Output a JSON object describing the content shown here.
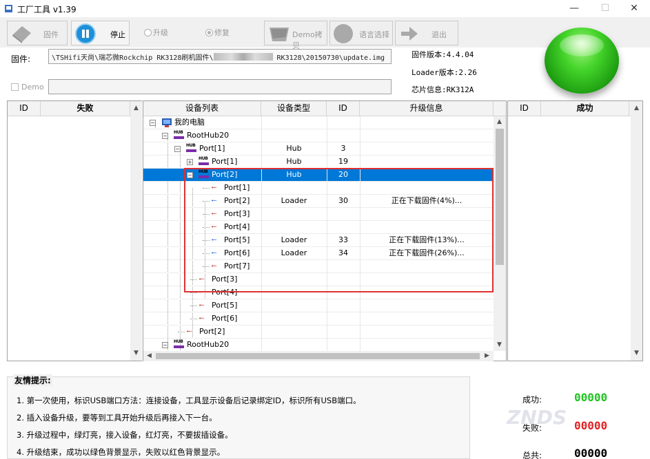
{
  "window": {
    "title": "工厂工具 v1.39",
    "minimize": "—",
    "maximize": "☐",
    "close": "✕"
  },
  "toolbar": {
    "firmware_label": "固件",
    "stop_label": "停止",
    "upgrade_label": "升级",
    "repair_label": "修复",
    "demo_copy_label": "Demo拷贝",
    "language_label": "语言选择",
    "exit_label": "退出"
  },
  "firmware": {
    "label": "固件:",
    "path_prefix": "\\TSHifi天尚\\瑞芯微Rockchip RK3128刷机固件\\",
    "path_suffix": "RK3128\\20150730\\update.img"
  },
  "info": {
    "fw_version_label": "固件版本:",
    "fw_version": "4.4.04",
    "loader_version_label": "Loader版本:",
    "loader_version": "2.26",
    "chip_label": "芯片信息:",
    "chip": "RK312A"
  },
  "demo": {
    "label": "Demo"
  },
  "fail_panel": {
    "col_id": "ID",
    "col_title": "失败"
  },
  "success_panel": {
    "col_id": "ID",
    "col_title": "成功"
  },
  "device_table": {
    "headers": [
      "设备列表",
      "设备类型",
      "ID",
      "升级信息"
    ],
    "rows": [
      {
        "name": "我的电脑",
        "type": "",
        "id": "",
        "info": ""
      },
      {
        "name": "RootHub20",
        "type": "",
        "id": "",
        "info": ""
      },
      {
        "name": "Port[1]",
        "type": "Hub",
        "id": "3",
        "info": ""
      },
      {
        "name": "Port[1]",
        "type": "Hub",
        "id": "19",
        "info": ""
      },
      {
        "name": "Port[2]",
        "type": "Hub",
        "id": "20",
        "info": ""
      },
      {
        "name": "Port[1]",
        "type": "",
        "id": "",
        "info": ""
      },
      {
        "name": "Port[2]",
        "type": "Loader",
        "id": "30",
        "info": "正在下载固件(4%)..."
      },
      {
        "name": "Port[3]",
        "type": "",
        "id": "",
        "info": ""
      },
      {
        "name": "Port[4]",
        "type": "",
        "id": "",
        "info": ""
      },
      {
        "name": "Port[5]",
        "type": "Loader",
        "id": "33",
        "info": "正在下载固件(13%)..."
      },
      {
        "name": "Port[6]",
        "type": "Loader",
        "id": "34",
        "info": "正在下载固件(26%)..."
      },
      {
        "name": "Port[7]",
        "type": "",
        "id": "",
        "info": ""
      },
      {
        "name": "Port[3]",
        "type": "",
        "id": "",
        "info": ""
      },
      {
        "name": "Port[4]",
        "type": "",
        "id": "",
        "info": ""
      },
      {
        "name": "Port[5]",
        "type": "",
        "id": "",
        "info": ""
      },
      {
        "name": "Port[6]",
        "type": "",
        "id": "",
        "info": ""
      },
      {
        "name": "Port[2]",
        "type": "",
        "id": "",
        "info": ""
      },
      {
        "name": "RootHub20",
        "type": "",
        "id": "",
        "info": ""
      }
    ]
  },
  "tips": {
    "title": "友情提示:",
    "items": [
      "1. 第一次使用，标识USB端口方法：连接设备，工具显示设备后记录绑定ID，标识所有USB端口。",
      "2. 插入设备升级，要等到工具开始升级后再接入下一台。",
      "3. 升级过程中，绿灯亮，接入设备，红灯亮，不要拔插设备。",
      "4. 升级结束，成功以绿色背景显示，失败以红色背景显示。"
    ]
  },
  "stats": {
    "success_label": "成功:",
    "success_value": "00000",
    "fail_label": "失败:",
    "fail_value": "00000",
    "total_label": "总共:",
    "total_value": "00000"
  },
  "colors": {
    "success": "#22c322",
    "fail": "#e02424",
    "total": "#000000",
    "selection": "#0078d7",
    "highlight_box": "#e03030"
  },
  "watermark": {
    "text": "ZNDS"
  }
}
